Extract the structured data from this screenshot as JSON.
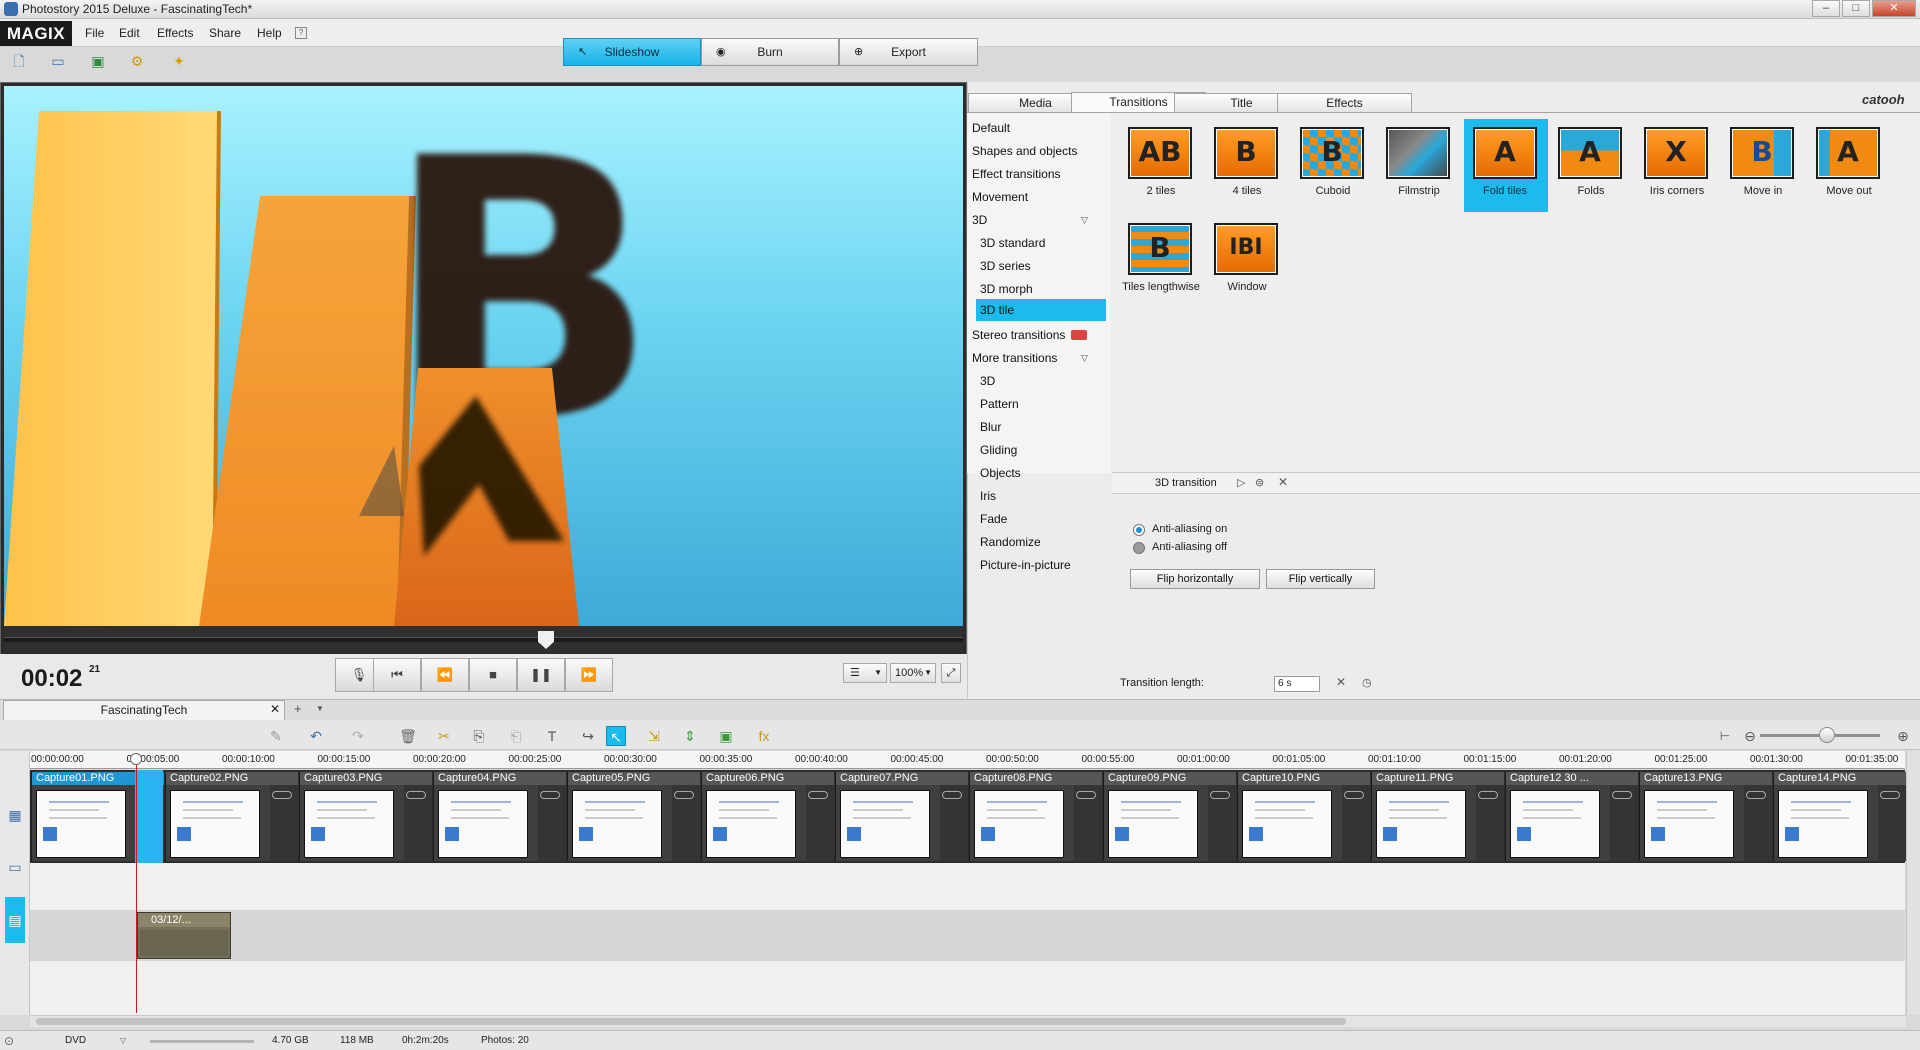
{
  "window": {
    "title": "Photostory 2015 Deluxe - FascinatingTech*"
  },
  "brand": {
    "logo": "MAGIX",
    "partner": "catooh"
  },
  "menu": [
    "File",
    "Edit",
    "Effects",
    "Share",
    "Help"
  ],
  "modes": [
    {
      "label": "Slideshow",
      "icon": "cursor-icon",
      "active": true
    },
    {
      "label": "Burn",
      "icon": "disc-icon",
      "active": false
    },
    {
      "label": "Export",
      "icon": "globe-icon",
      "active": false
    }
  ],
  "preview": {
    "timecode": "00:02",
    "timecode_frames": "21",
    "zoom": "100%",
    "seek_fraction": 0.565
  },
  "panel_tabs": [
    "Media",
    "Transitions",
    "Title",
    "Effects"
  ],
  "active_panel_tab": "Transitions",
  "categories": [
    {
      "label": "Default",
      "level": 0
    },
    {
      "label": "Shapes and objects",
      "level": 0
    },
    {
      "label": "Effect transitions",
      "level": 0
    },
    {
      "label": "Movement",
      "level": 0
    },
    {
      "label": "3D",
      "level": 0,
      "expanded": true
    },
    {
      "label": "3D standard",
      "level": 1
    },
    {
      "label": "3D series",
      "level": 1
    },
    {
      "label": "3D morph",
      "level": 1
    },
    {
      "label": "3D tile",
      "level": 1,
      "selected": true
    },
    {
      "label": "Stereo transitions",
      "level": 0,
      "badge": true
    },
    {
      "label": "More transitions",
      "level": 0,
      "expanded": true
    },
    {
      "label": "3D",
      "level": 1
    },
    {
      "label": "Pattern",
      "level": 1
    },
    {
      "label": "Blur",
      "level": 1
    },
    {
      "label": "Gliding",
      "level": 1
    },
    {
      "label": "Objects",
      "level": 1
    },
    {
      "label": "Iris",
      "level": 1
    },
    {
      "label": "Fade",
      "level": 1
    },
    {
      "label": "Randomize",
      "level": 1
    },
    {
      "label": "Picture-in-picture",
      "level": 1
    }
  ],
  "transitions": [
    {
      "label": "2 tiles",
      "glyph": "AB"
    },
    {
      "label": "4 tiles",
      "glyph": "B"
    },
    {
      "label": "Cuboid",
      "glyph": "B"
    },
    {
      "label": "Filmstrip",
      "glyph": ""
    },
    {
      "label": "Fold tiles",
      "glyph": "A",
      "selected": true
    },
    {
      "label": "Folds",
      "glyph": "A"
    },
    {
      "label": "Iris corners",
      "glyph": "X"
    },
    {
      "label": "Move in",
      "glyph": "B"
    },
    {
      "label": "Move out",
      "glyph": "A"
    },
    {
      "label": "Tiles lengthwise",
      "glyph": "B"
    },
    {
      "label": "Window",
      "glyph": "IBI"
    }
  ],
  "properties": {
    "title": "3D transition",
    "radio_on": "Anti-aliasing on",
    "radio_off": "Anti-aliasing off",
    "flip_h": "Flip horizontally",
    "flip_v": "Flip vertically",
    "length_label": "Transition length:",
    "length_value": "6 s"
  },
  "project": {
    "tab": "FascinatingTech"
  },
  "ruler": [
    "00:00:00:00",
    "00:00:05:00",
    "00:00:10:00",
    "00:00:15:00",
    "00:00:20:00",
    "00:00:25:00",
    "00:00:30:00",
    "00:00:35:00",
    "00:00:40:00",
    "00:00:45:00",
    "00:00:50:00",
    "00:00:55:00",
    "00:01:00:00",
    "00:01:05:00",
    "00:01:10:00",
    "00:01:15:00",
    "00:01:20:00",
    "00:01:25:00",
    "00:01:30:00",
    "00:01:35:00"
  ],
  "clips": [
    "Capture01.PNG",
    "Capture02.PNG",
    "Capture03.PNG",
    "Capture04.PNG",
    "Capture05.PNG",
    "Capture06.PNG",
    "Capture07.PNG",
    "Capture08.PNG",
    "Capture09.PNG",
    "Capture10.PNG",
    "Capture11.PNG",
    "Capture12 30 ...",
    "Capture13.PNG",
    "Capture14.PNG"
  ],
  "text_clip": {
    "label": "03/12/..."
  },
  "status": {
    "format": "DVD",
    "size": "4.70 GB",
    "used": "118 MB",
    "duration": "0h:2m:20s",
    "photos": "Photos: 20"
  },
  "colors": {
    "accent": "#1bbbee",
    "playhead": "#d3181b",
    "tile_orange": "#f08a10"
  }
}
